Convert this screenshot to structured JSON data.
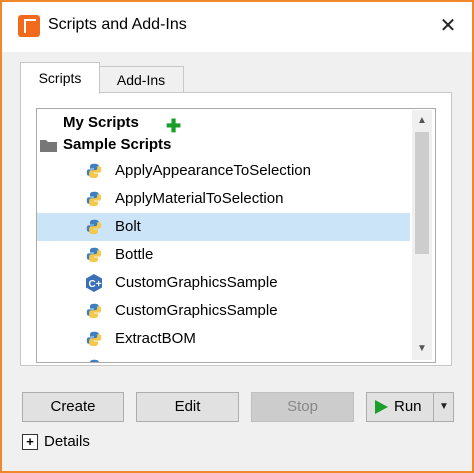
{
  "window": {
    "title": "Scripts and Add-Ins",
    "accent_color": "#f0882b",
    "close_glyph": "✕"
  },
  "tabs": [
    {
      "label": "Scripts",
      "active": true
    },
    {
      "label": "Add-Ins",
      "active": false
    }
  ],
  "tree": {
    "my_scripts": "My Scripts",
    "sample_scripts": "Sample Scripts",
    "items": [
      {
        "label": "ApplyAppearanceToSelection",
        "icon": "python-icon",
        "selected": false
      },
      {
        "label": "ApplyMaterialToSelection",
        "icon": "python-icon",
        "selected": false
      },
      {
        "label": "Bolt",
        "icon": "python-icon",
        "selected": true
      },
      {
        "label": "Bottle",
        "icon": "python-icon",
        "selected": false
      },
      {
        "label": "CustomGraphicsSample",
        "icon": "cpp-icon",
        "selected": false
      },
      {
        "label": "CustomGraphicsSample",
        "icon": "python-icon",
        "selected": false
      },
      {
        "label": "ExtractBOM",
        "icon": "python-icon",
        "selected": false
      }
    ]
  },
  "buttons": {
    "create": "Create",
    "edit": "Edit",
    "stop": "Stop",
    "run": "Run"
  },
  "details": {
    "label": "Details",
    "expanded": false
  }
}
